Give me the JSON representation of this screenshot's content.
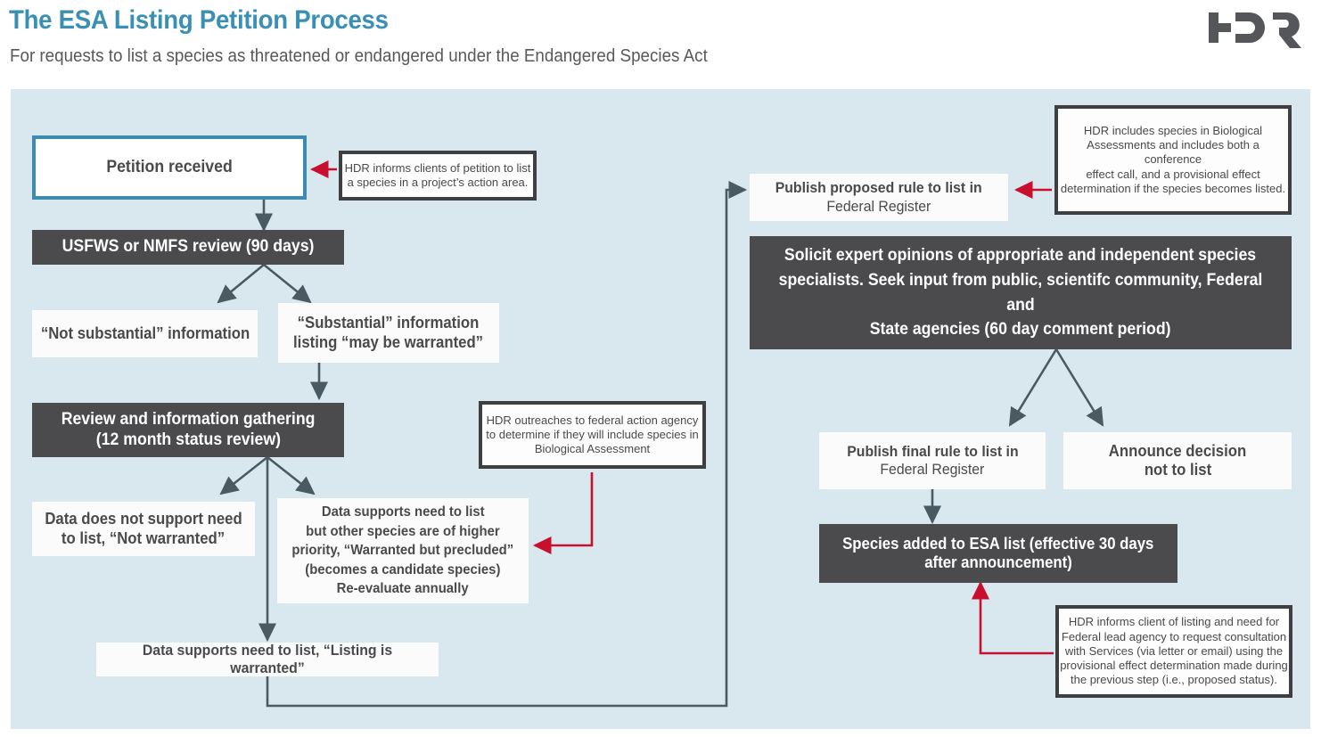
{
  "header": {
    "title": "The ESA Listing Petition Process",
    "subtitle": "For requests to list a species as threatened or endangered under the Endangered Species Act",
    "logo_alt": "HDR"
  },
  "colors": {
    "accent_teal": "#3d8cb0",
    "panel_bg": "#d9e8ef",
    "dark_box": "#4b4b4e",
    "white_box": "#fbfbfb",
    "callout_border": "#3f3f42",
    "arrow_gray": "#4a5a63",
    "arrow_red": "#c8102e",
    "title_color": "#3a8fb5",
    "body_text": "#4a4a4d"
  },
  "nodes": {
    "petition_received": {
      "label": "Petition received"
    },
    "agency_review": {
      "label": "USFWS or NMFS review (90 days)"
    },
    "not_substantial": {
      "label": "“Not substantial” information"
    },
    "substantial": {
      "line1": "“Substantial” information",
      "line2": "listing “may be warranted”"
    },
    "review_gathering": {
      "line1": "Review and information gathering",
      "line2": "(12 month status review)"
    },
    "not_warranted": {
      "line1": "Data does not support need",
      "line2": "to list, “Not warranted”"
    },
    "warranted_precluded": {
      "line1": "Data supports need to list",
      "line2": "but other species are of higher",
      "line3": "priority, “Warranted but precluded”",
      "line4": "(becomes a candidate species)",
      "line5": "Re-evaluate annually"
    },
    "listing_warranted": {
      "label": "Data supports need to list, “Listing is warranted”"
    },
    "publish_proposed": {
      "line1": "Publish proposed rule to list in",
      "line2": "Federal Register"
    },
    "solicit_experts": {
      "line1": "Solicit expert opinions of appropriate and independent species",
      "line2": "specialists. Seek input from public, scientifc community, Federal and",
      "line3": "State agencies (60 day comment period)"
    },
    "publish_final": {
      "line1": "Publish final rule to list in",
      "line2": "Federal Register"
    },
    "announce_not_list": {
      "line1": "Announce decision",
      "line2": "not to list"
    },
    "species_added": {
      "line1": "Species added to ESA list (effective 30 days",
      "line2": "after announcement)"
    }
  },
  "callouts": {
    "petition_note": {
      "line1": "HDR informs clients of petition to list",
      "line2": "a species in a project’s action area."
    },
    "outreach_note": {
      "line1": "HDR outreaches to federal action agency",
      "line2": "to determine if they will include species in",
      "line3": "Biological Assessment"
    },
    "biological_assessment_note": {
      "line1": "HDR includes species in Biological",
      "line2": "Assessments and includes both a conference",
      "line3": "effect call, and a provisional effect",
      "line4": "determination if the species becomes listed."
    },
    "consultation_note": {
      "line1": "HDR informs client of listing and need for",
      "line2": "Federal lead agency to request consultation",
      "line3": "with Services (via letter or email) using the",
      "line4": "provisional effect determination made during",
      "line5": "the previous step (i.e., proposed status)."
    }
  },
  "chart_data": {
    "type": "diagram",
    "title": "The ESA Listing Petition Process",
    "edges": [
      {
        "from": "petition_note",
        "to": "petition_received",
        "color": "red"
      },
      {
        "from": "petition_received",
        "to": "agency_review",
        "color": "gray"
      },
      {
        "from": "agency_review",
        "to": "not_substantial",
        "color": "gray"
      },
      {
        "from": "agency_review",
        "to": "substantial",
        "color": "gray"
      },
      {
        "from": "substantial",
        "to": "review_gathering",
        "color": "gray"
      },
      {
        "from": "review_gathering",
        "to": "not_warranted",
        "color": "gray"
      },
      {
        "from": "review_gathering",
        "to": "warranted_precluded",
        "color": "gray"
      },
      {
        "from": "review_gathering",
        "to": "listing_warranted",
        "color": "gray"
      },
      {
        "from": "outreach_note",
        "to": "warranted_precluded",
        "color": "red"
      },
      {
        "from": "listing_warranted",
        "to": "publish_proposed",
        "color": "gray"
      },
      {
        "from": "biological_assessment_note",
        "to": "publish_proposed",
        "color": "red"
      },
      {
        "from": "solicit_experts",
        "to": "publish_final",
        "color": "gray"
      },
      {
        "from": "solicit_experts",
        "to": "announce_not_list",
        "color": "gray"
      },
      {
        "from": "publish_final",
        "to": "species_added",
        "color": "gray"
      },
      {
        "from": "consultation_note",
        "to": "species_added",
        "color": "red"
      }
    ]
  }
}
